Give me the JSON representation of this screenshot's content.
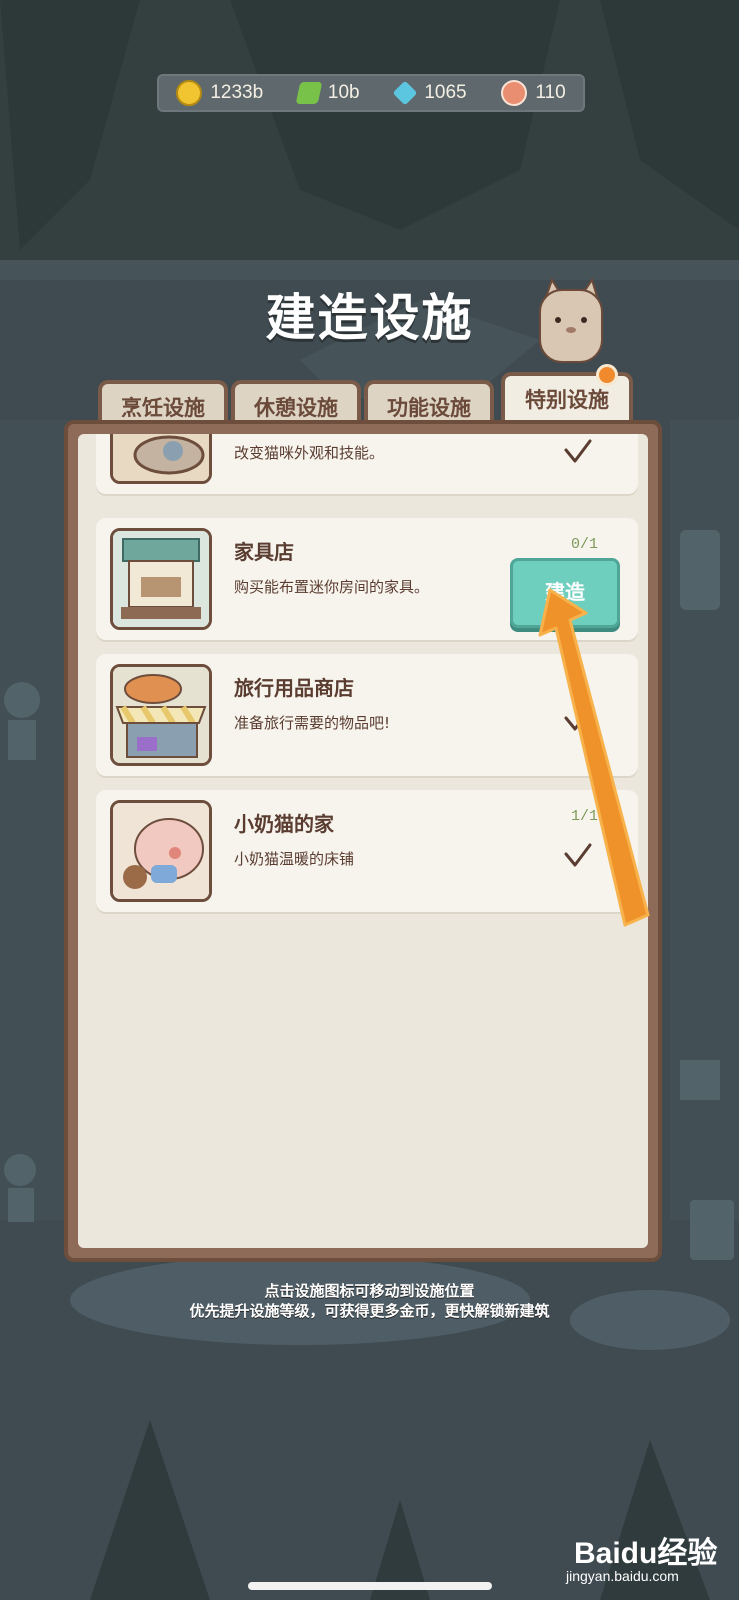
{
  "resources": [
    {
      "icon": "gold-coin-icon",
      "value": "1233b",
      "color": "#f0c531"
    },
    {
      "icon": "energy-bolt-icon",
      "value": "10b",
      "color": "#79c24a"
    },
    {
      "icon": "blue-gem-icon",
      "value": "1065",
      "color": "#5cc6e0"
    },
    {
      "icon": "fish-cake-icon",
      "value": "110",
      "color": "#e98e70"
    }
  ],
  "title": "建造设施",
  "tabs": [
    {
      "label": "烹饪设施",
      "active": false
    },
    {
      "label": "休憩设施",
      "active": false
    },
    {
      "label": "功能设施",
      "active": false
    },
    {
      "label": "特别设施",
      "active": true
    }
  ],
  "cards": [
    {
      "name": "",
      "desc": "改变猫咪外观和技能。",
      "count": "",
      "status": "done"
    },
    {
      "name": "家具店",
      "desc": "购买能布置迷你房间的家具。",
      "count": "0/1",
      "status": "build",
      "button": "建造"
    },
    {
      "name": "旅行用品商店",
      "desc": "准备旅行需要的物品吧!",
      "count": "",
      "status": "done"
    },
    {
      "name": "小奶猫的家",
      "desc": "小奶猫温暖的床铺",
      "count": "1/1",
      "status": "done"
    }
  ],
  "hints": [
    "点击设施图标可移动到设施位置",
    "优先提升设施等级，可获得更多金币，更快解锁新建筑"
  ],
  "watermark": {
    "logo": "Baidu经验",
    "url": "jingyan.baidu.com"
  },
  "colors": {
    "accent": "#6fcfbf",
    "arrow": "#f0922a",
    "panel": "#8d6b58"
  }
}
